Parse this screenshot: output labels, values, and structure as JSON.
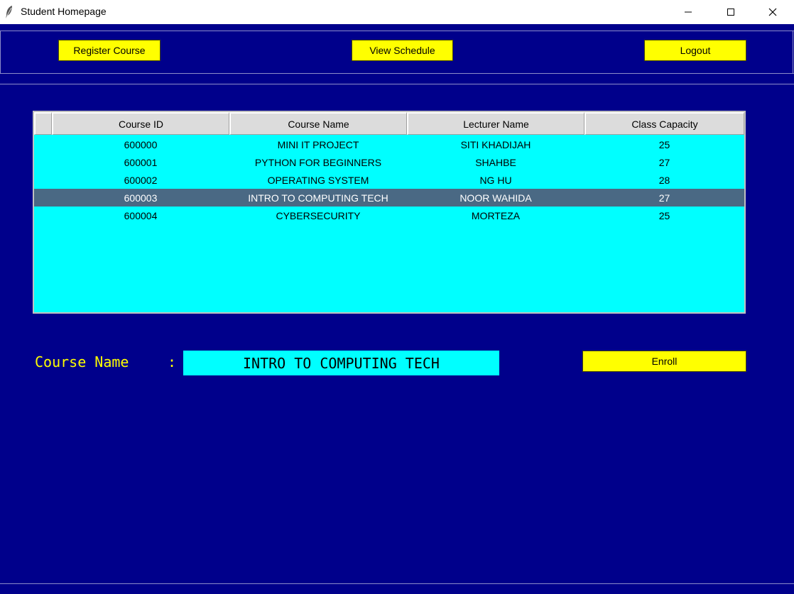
{
  "window": {
    "title": "Student Homepage"
  },
  "toolbar": {
    "register_label": "Register Course",
    "schedule_label": "View Schedule",
    "logout_label": "Logout"
  },
  "table": {
    "columns": [
      "Course ID",
      "Course Name",
      "Lecturer Name",
      "Class Capacity"
    ],
    "rows": [
      {
        "id": "600000",
        "name": "MINI IT PROJECT",
        "lecturer": "SITI KHADIJAH",
        "capacity": "25"
      },
      {
        "id": "600001",
        "name": "PYTHON FOR BEGINNERS",
        "lecturer": "SHAHBE",
        "capacity": "27"
      },
      {
        "id": "600002",
        "name": "OPERATING SYSTEM",
        "lecturer": "NG HU",
        "capacity": "28"
      },
      {
        "id": "600003",
        "name": "INTRO TO COMPUTING TECH",
        "lecturer": "NOOR WAHIDA",
        "capacity": "27"
      },
      {
        "id": "600004",
        "name": "CYBERSECURITY",
        "lecturer": "MORTEZA",
        "capacity": "25"
      }
    ],
    "selected_row_index": 3
  },
  "form": {
    "course_label": "Course Name",
    "colon": ":",
    "course_value": "INTRO TO COMPUTING TECH",
    "enroll_label": "Enroll"
  },
  "colors": {
    "background": "#00008b",
    "button": "#ffff00",
    "table_bg": "#00ffff",
    "selected_row": "#4a6984",
    "label_text": "#ffff00"
  },
  "icons": [
    "feather-icon",
    "minimize-icon",
    "maximize-icon",
    "close-icon"
  ]
}
